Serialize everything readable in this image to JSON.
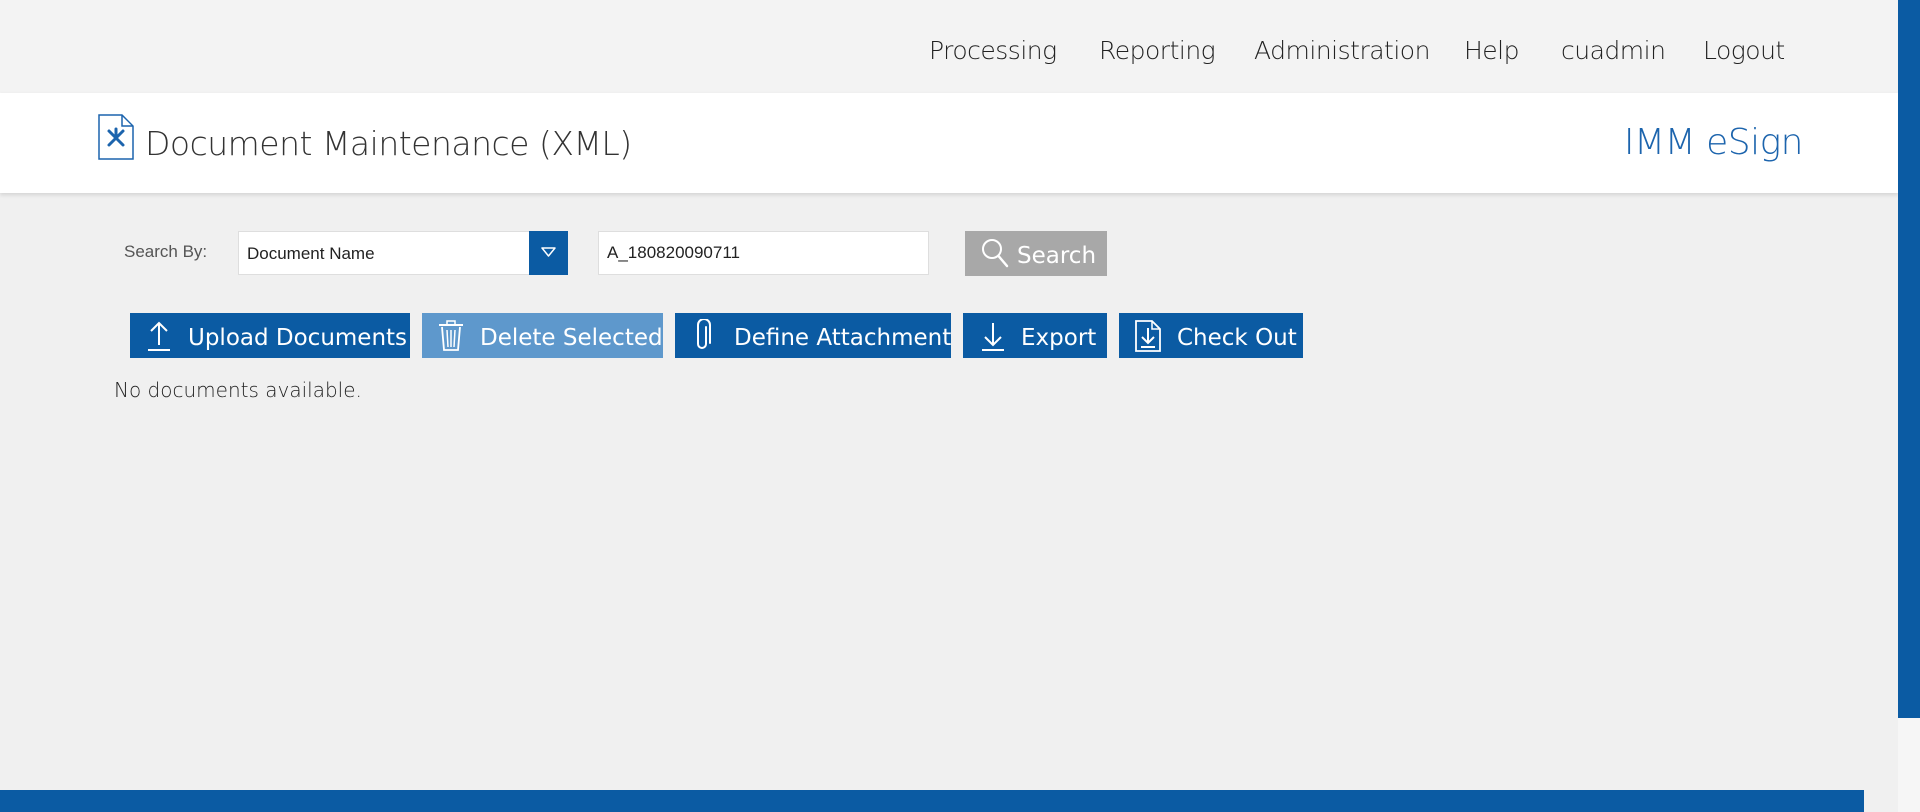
{
  "nav": {
    "items": [
      {
        "label": "Processing"
      },
      {
        "label": "Reporting"
      },
      {
        "label": "Administration"
      },
      {
        "label": "Help"
      },
      {
        "label": "cuadmin"
      },
      {
        "label": "Logout"
      }
    ]
  },
  "header": {
    "title": "Document Maintenance (XML)",
    "brand": "IMM eSign",
    "icon": "document-tools-icon"
  },
  "search": {
    "label": "Search By:",
    "field_selected": "Document Name",
    "value": "A_180820090711",
    "button_label": "Search"
  },
  "actions": {
    "upload": {
      "label": "Upload Documents",
      "icon": "upload-icon"
    },
    "delete": {
      "label": "Delete Selected",
      "icon": "trash-icon",
      "disabled": true
    },
    "define_attachment": {
      "label": "Define Attachment",
      "icon": "paperclip-icon"
    },
    "export": {
      "label": "Export",
      "icon": "download-icon"
    },
    "check_out": {
      "label": "Check Out",
      "icon": "document-download-icon"
    }
  },
  "results": {
    "empty_message": "No documents available."
  },
  "colors": {
    "primary": "#0b5ba3",
    "primary_disabled": "#5e98cc",
    "brand_text": "#1c64ad",
    "search_button": "#a8a8a8"
  }
}
